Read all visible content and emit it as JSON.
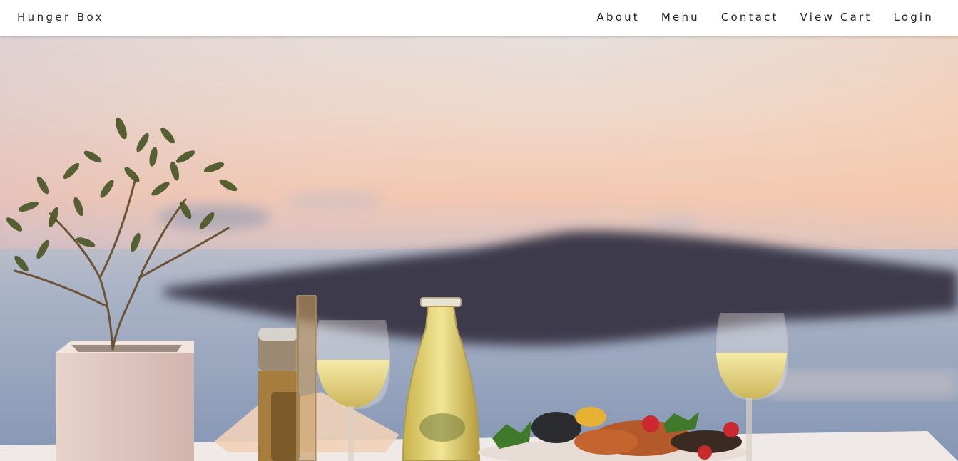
{
  "navbar": {
    "brand": "Hunger Box",
    "links": [
      {
        "label": "About"
      },
      {
        "label": "Menu"
      },
      {
        "label": "Contact"
      },
      {
        "label": "View Cart"
      },
      {
        "label": "Login"
      }
    ]
  },
  "hero": {
    "image": "sunset-dinner-table-photo",
    "colors": {
      "sky_top": "#e9e1dc",
      "sky_mid": "#f3cdb6",
      "sea": "#9aa7bd",
      "island": "#3c3a4a"
    }
  }
}
